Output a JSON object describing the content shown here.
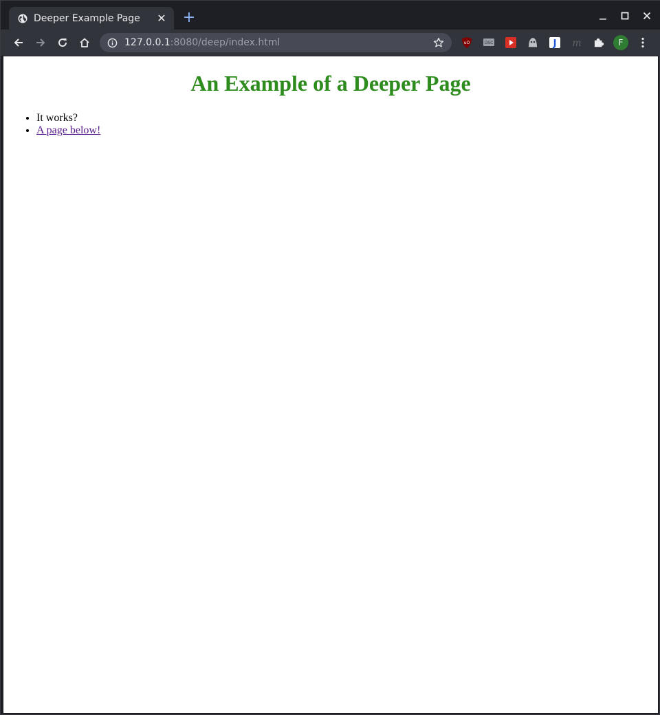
{
  "browser": {
    "tab": {
      "title": "Deeper Example Page",
      "close_glyph": "✕"
    },
    "new_tab_glyph": "+",
    "address_bar": {
      "host": "127.0.0.1",
      "rest": ":8080/deep/index.html"
    },
    "profile_initial": "F",
    "extensions": [
      "ublock-icon",
      "dsc-icon",
      "video-icon",
      "ghostery-icon",
      "j-icon",
      "m-icon",
      "puzzle-icon"
    ]
  },
  "page": {
    "heading": "An Example of a Deeper Page",
    "items": [
      {
        "text": "It works?"
      },
      {
        "text": "A page below!",
        "link": true
      }
    ]
  },
  "colors": {
    "heading": "#2e8b1d",
    "visited_link": "#551a8b",
    "toolbar": "#32343c",
    "frame": "#1e1f24"
  }
}
